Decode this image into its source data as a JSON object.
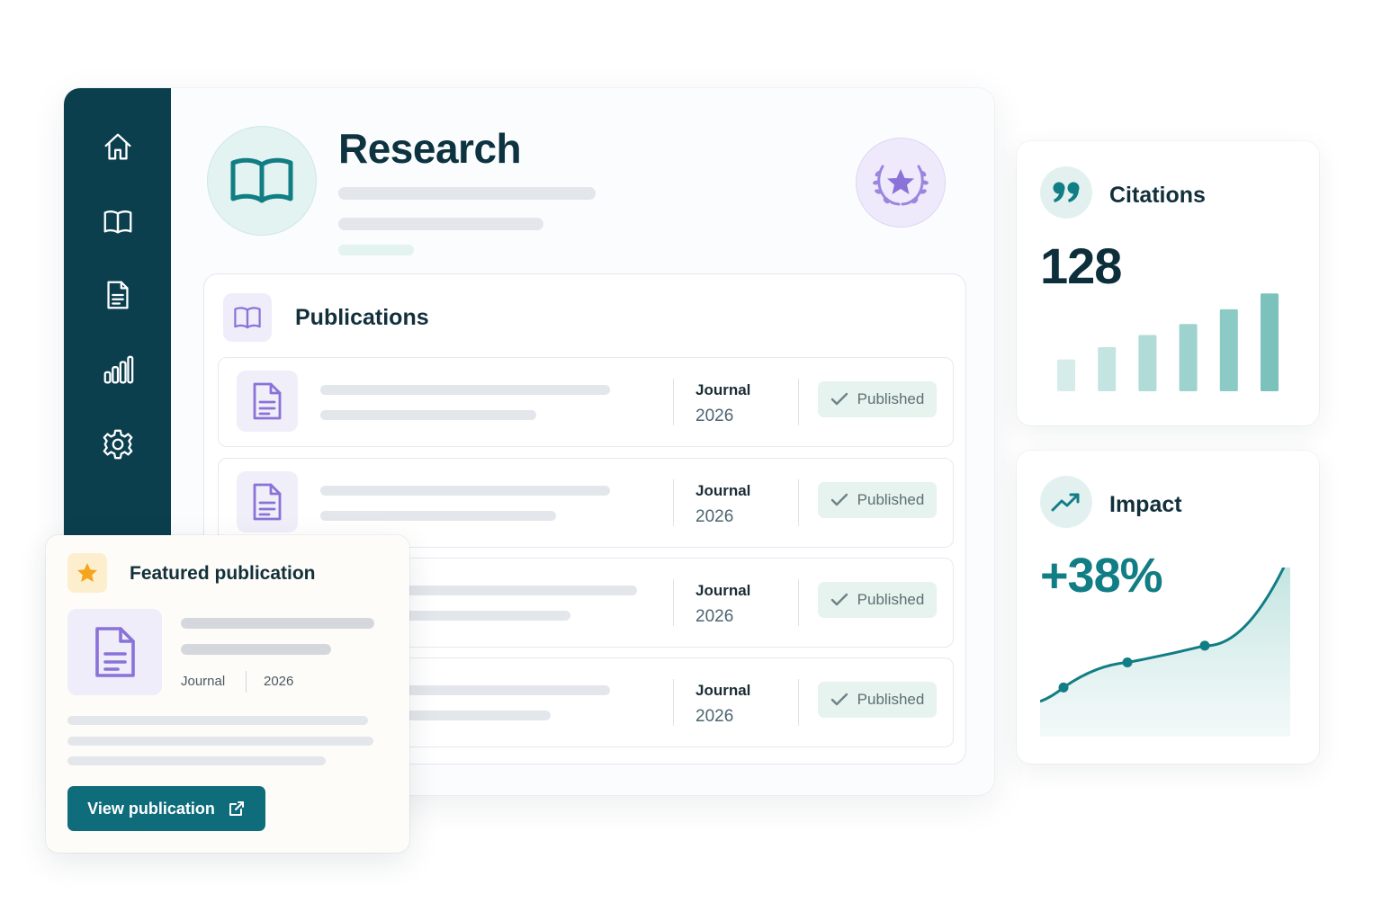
{
  "colors": {
    "sidebar": "#0b3f4e",
    "accent_teal": "#0f6c7b",
    "accent_purple": "#8a72d8",
    "success_bg": "#e6f3ef",
    "star": "#f4a51d"
  },
  "sidebar": {
    "items": [
      {
        "icon": "home-icon"
      },
      {
        "icon": "book-icon"
      },
      {
        "icon": "document-icon"
      },
      {
        "icon": "bar-chart-icon"
      },
      {
        "icon": "gear-icon"
      }
    ]
  },
  "header": {
    "title": "Research",
    "icon": "open-book-icon",
    "badge_icon": "laurel-star-icon"
  },
  "publications": {
    "title": "Publications",
    "rows": [
      {
        "type": "Journal",
        "year": "2026",
        "status": "Published"
      },
      {
        "type": "Journal",
        "year": "2026",
        "status": "Published"
      },
      {
        "type": "Journal",
        "year": "2026",
        "status": "Published"
      },
      {
        "type": "Journal",
        "year": "2026",
        "status": "Published"
      }
    ]
  },
  "featured": {
    "title": "Featured publication",
    "type": "Journal",
    "year": "2026",
    "button_label": "View publication"
  },
  "citations": {
    "label": "Citations",
    "value": "128",
    "icon": "quote-icon",
    "bars": [
      0.26,
      0.36,
      0.46,
      0.55,
      0.67,
      0.8
    ]
  },
  "impact": {
    "label": "Impact",
    "value": "+38%",
    "icon": "trend-up-icon",
    "trend": [
      0.12,
      0.3,
      0.42,
      0.8
    ]
  }
}
